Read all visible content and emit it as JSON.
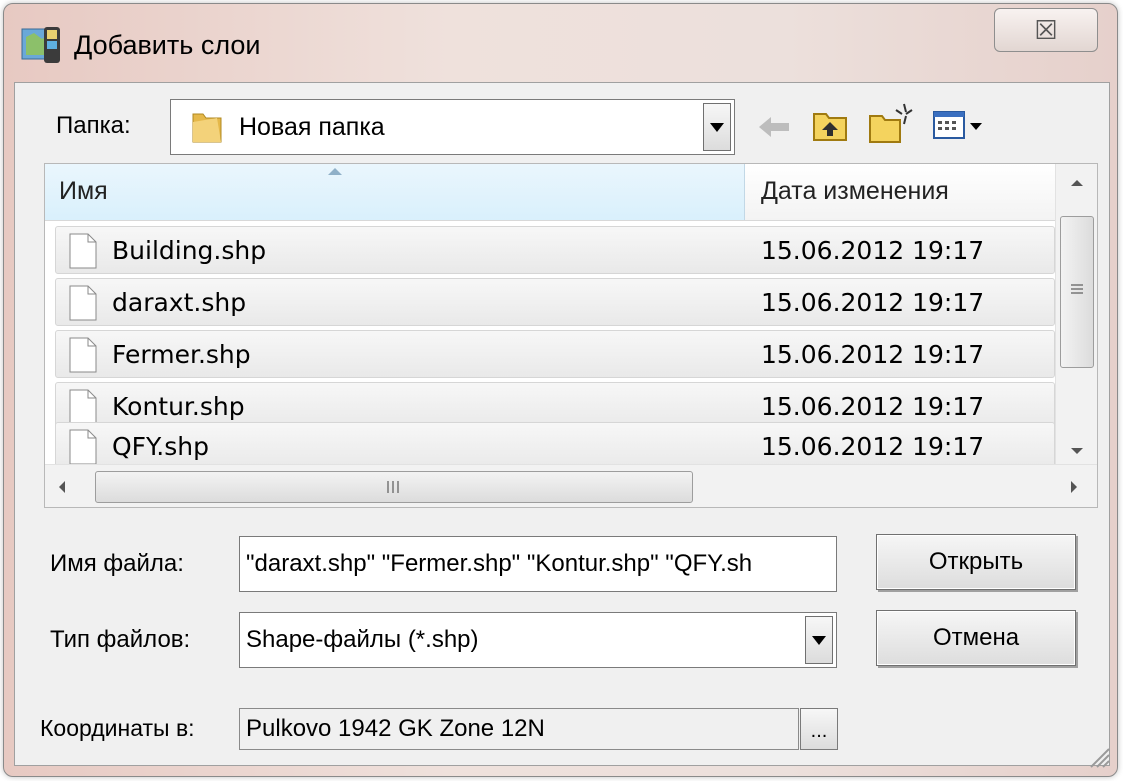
{
  "window": {
    "title": "Добавить слои",
    "close_glyph": "☒"
  },
  "folder": {
    "label": "Папка:",
    "value": "Новая папка",
    "icons": [
      "back-arrow-icon",
      "up-folder-icon",
      "new-folder-icon",
      "view-menu-icon"
    ]
  },
  "list": {
    "columns": [
      "Имя",
      "Дата изменения"
    ],
    "rows": [
      {
        "name": "Building.shp",
        "date": "15.06.2012 19:17"
      },
      {
        "name": "daraxt.shp",
        "date": "15.06.2012 19:17"
      },
      {
        "name": "Fermer.shp",
        "date": "15.06.2012 19:17"
      },
      {
        "name": "Kontur.shp",
        "date": "15.06.2012 19:17"
      },
      {
        "name": "QFY.shp",
        "date": "15.06.2012 19:17"
      }
    ]
  },
  "filename": {
    "label": "Имя файла:",
    "value": "\"daraxt.shp\" \"Fermer.shp\" \"Kontur.shp\" \"QFY.sh"
  },
  "filetype": {
    "label": "Тип файлов:",
    "value": "Shape-файлы (*.shp)"
  },
  "buttons": {
    "open": "Открыть",
    "cancel": "Отмена",
    "browse": "..."
  },
  "coords": {
    "label": "Координаты в:",
    "value": "Pulkovo  1942  GK  Zone  12N"
  }
}
